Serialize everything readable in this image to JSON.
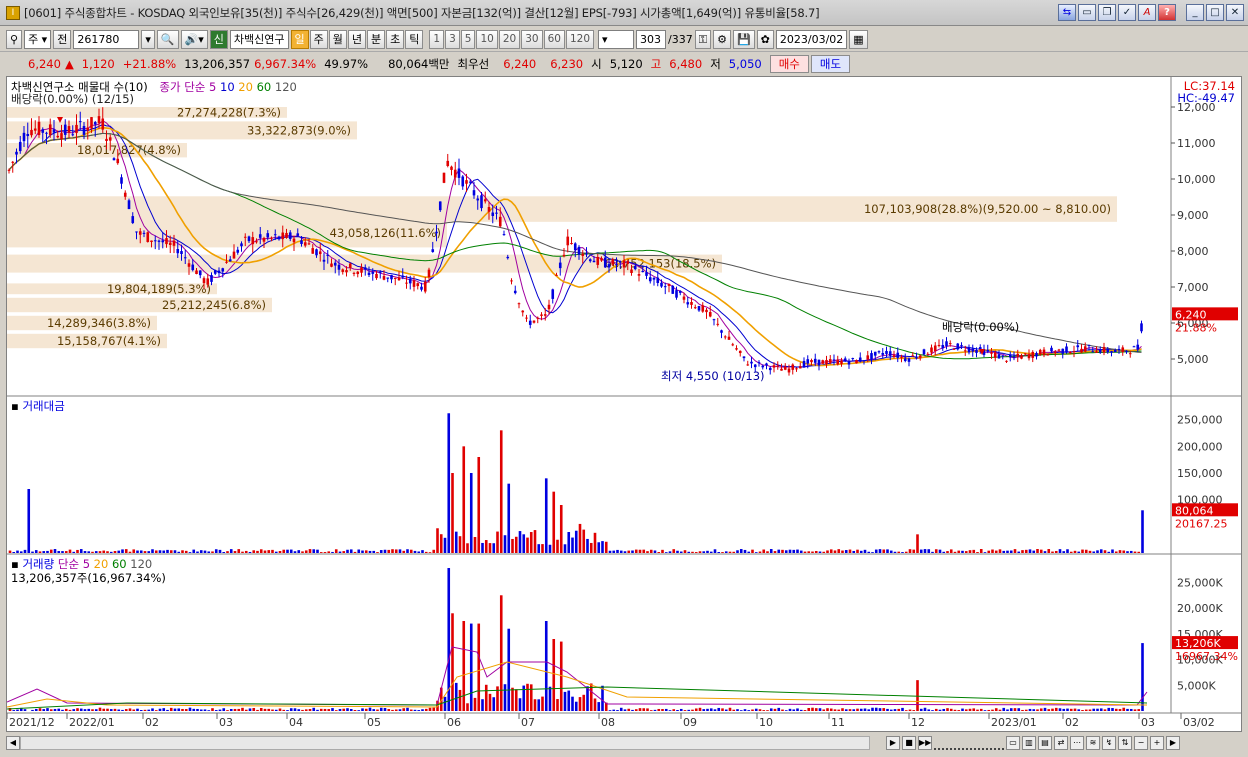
{
  "window": {
    "title": "[0601] 주식종합차트 - KOSDAQ 외국인보유[35(천)] 주식수[26,429(천)] 액면[500] 자본금[132(억)] 결산[12월] EPS[-793] 시가총액[1,649(억)] 유통비율[58.7]",
    "app_icon": "Ⅰ"
  },
  "toolbar": {
    "market": "주",
    "all": "전",
    "code": "261780",
    "stock_name_badge": "신",
    "stock_name": "차백신연구",
    "periods": [
      "일",
      "주",
      "월",
      "년",
      "분",
      "초",
      "틱"
    ],
    "active_period": "일",
    "minute_options": [
      "1",
      "3",
      "5",
      "10",
      "20",
      "30",
      "60",
      "120"
    ],
    "count_display": "303",
    "count_total": "/337",
    "date": "2023/03/02"
  },
  "quote": {
    "price": "6,240",
    "arrow": "▲",
    "change": "1,120",
    "change_pct": "+21.88%",
    "volume": "13,206,357",
    "volume_ratio": "6,967.34%",
    "turnover": "49.97%",
    "amount": "80,064백만",
    "priority_label": "최우선",
    "ask": "6,240",
    "bid": "6,230",
    "open_label": "시",
    "open": "5,120",
    "high_label": "고",
    "high": "6,480",
    "low_label": "저",
    "low": "5,050",
    "buy_label": "매수",
    "sell_label": "매도"
  },
  "price_panel": {
    "legend": "차백신연구소 매물대 수(10)",
    "ma_label": "종가 단순",
    "ma_periods": [
      "5",
      "10",
      "20",
      "60",
      "120"
    ],
    "sub_legend": "배당락(0.00%) (12/15)",
    "lc": "LC:37.14",
    "hc": "HC:-49.47",
    "price_tag": "6,240",
    "pct_tag": "21.88%",
    "dividend_note": "배당락(0.00%)",
    "low_note": "최저 4,550 (10/13)",
    "y_ticks": [
      "12,000",
      "11,000",
      "10,000",
      "9,000",
      "8,000",
      "7,000",
      "6,000",
      "5,000"
    ],
    "volume_profile": [
      "27,274,228(7.3%)",
      "33,322,873(9.0%)",
      "18,017,827(4.8%)",
      "107,103,908(28.8%)(9,520.00 ~ 8,810.00)",
      "43,058,126(11.6%)",
      "68,752,153(18.5%)",
      "19,804,189(5.3%)",
      "25,212,245(6.8%)",
      "14,289,346(3.8%)",
      "15,158,767(4.1%)"
    ]
  },
  "amount_panel": {
    "title": "거래대금",
    "y_ticks": [
      "250,000",
      "200,000",
      "150,000",
      "100,000"
    ],
    "value_tag": "80,064",
    "sub_tag": "20167.25"
  },
  "volume_panel": {
    "title": "거래량",
    "ma_label": "단순",
    "ma_periods": [
      "5",
      "20",
      "60",
      "120"
    ],
    "summary": "13,206,357주(16,967.34%)",
    "y_ticks": [
      "25,000K",
      "20,000K",
      "15,000K",
      "10,000K",
      "5,000K"
    ],
    "value_tag": "13,206K",
    "sub_tag": "16967.34%"
  },
  "x_axis": [
    "2021/12",
    "2022/01",
    "02",
    "03",
    "04",
    "05",
    "06",
    "07",
    "08",
    "09",
    "10",
    "11",
    "12",
    "2023/01",
    "02",
    "03",
    "03/02"
  ],
  "colors": {
    "up": "#e00000",
    "down": "#0000e0",
    "ma5": "#a000a0",
    "ma10": "#0000d0",
    "ma20": "#f0a000",
    "ma60": "#008000",
    "ma120": "#555555",
    "profile": "#f5e6d3"
  }
}
